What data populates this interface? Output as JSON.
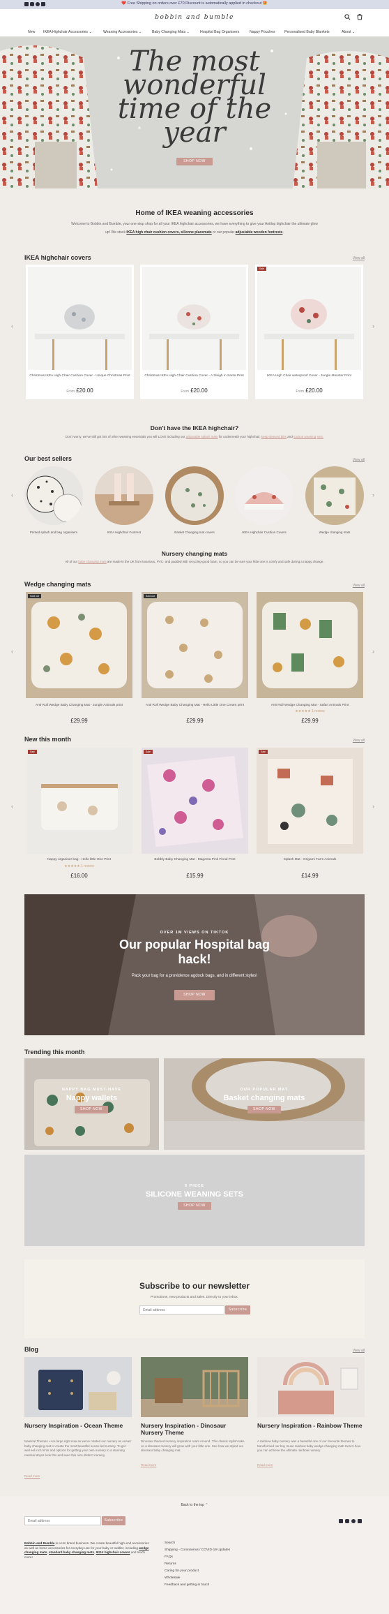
{
  "announcement": {
    "text": "❤️ Free Shipping on orders over £70 Discount is automatically applied in checkout 🤩"
  },
  "header": {
    "logo": "bobbin and bumble"
  },
  "nav": [
    "New",
    "IKEA Highchair Accessories ⌄",
    "Weaning Accessories ⌄",
    "Baby Changing Mats ⌄",
    "Hospital Bag Organisers",
    "Nappy Pouches",
    "Personalised Baby Blankets",
    "About ⌄"
  ],
  "hero": {
    "title": "The most wonderful time of the year",
    "button": "SHOP NOW"
  },
  "intro": {
    "title": "Home of IKEA weaning accessories",
    "line1": "Welcome to Bobbin and Bumble, your one-stop shop for all your IKEA highchair accessories, we have everything to give your Antilop highchair the ultimate glow",
    "line2_pre": "up! We stock ",
    "line2_links": "IKEA high chair cushion covers, silicone placemats",
    "line2_mid": " or our popular ",
    "line2_link2": "adjustable wooden footrests",
    "line2_end": "."
  },
  "ikea": {
    "title": "IKEA highchair covers",
    "view_all": "View all",
    "cards": [
      {
        "title": "Christmas IKEA High Chair Cushion Cover - Unique Christmas Print",
        "from": "From",
        "price": "£20.00",
        "badge": ""
      },
      {
        "title": "Christmas IKEA High Chair Cushion Cover - A Sleigh in Santa Print",
        "from": "From",
        "price": "£20.00",
        "badge": ""
      },
      {
        "title": "IKEA High Chair waterproof Cover - Jungle Monster Print",
        "from": "From",
        "price": "£20.00",
        "badge": "Sale"
      }
    ]
  },
  "no_ikea": {
    "title": "Don't have the IKEA highchair?",
    "line1_pre": "Don't worry, we've still got lots of other weaning essentials you will LOVE including our ",
    "line1_link1": "adjustable splash mats",
    "line1_mid": " for underneath your highchair, ",
    "line1_link2": "keep-sleeved bibs",
    "line1_mid2": " and ",
    "line1_link3": "suction weaning",
    "line2": "sets."
  },
  "best": {
    "title": "Our best sellers",
    "view_all": "View all",
    "items": [
      "Printed splash and bag organisers",
      "IKEA Highchair Footrest",
      "Basket Changing mat covers",
      "IKEA Highchair Cushion Covers",
      "Wedge changing mats"
    ]
  },
  "mats_intro": {
    "title": "Nursery changing mats",
    "pre": "All of our ",
    "link": "baby changing mats",
    "rest": " are made in the UK from luxurious, PVC- and padded with recycling-good foam, so you can be sure your little one is comfy and safe during a nappy",
    "line2": "change."
  },
  "wedge": {
    "title": "Wedge changing mats",
    "view_all": "View all",
    "cards": [
      {
        "title": "Anti Roll Wedge Baby Changing Mat - Jungle Animals print",
        "price": "£29.99",
        "badge": "Sold out",
        "stars": ""
      },
      {
        "title": "Anti Roll Wedge Baby Changing Mat - Hello Little One Cream print",
        "price": "£29.99",
        "badge": "Sold out",
        "stars": ""
      },
      {
        "title": "Anti Roll Wedge Changing Mat - Safari Animals Print",
        "price": "£29.99",
        "badge": "",
        "stars": "★★★★★ 1 review"
      }
    ]
  },
  "new": {
    "title": "New this month",
    "view_all": "View all",
    "cards": [
      {
        "title": "Nappy organiser bag - Hello little One Print",
        "price": "£16.00",
        "badge": "Sale",
        "stars": "★★★★★ 1 review"
      },
      {
        "title": "Bobbly Baby Changing Mat - Magenta Pink Floral Print",
        "price": "£15.99",
        "badge": "Sale",
        "stars": ""
      },
      {
        "title": "Splash Mat - Origami Farm Animals",
        "price": "£14.99",
        "badge": "Sale",
        "stars": ""
      }
    ]
  },
  "tiktok": {
    "over": "OVER 1M VIEWS ON TIKTOK",
    "title1": "Our popular Hospital bag",
    "title2": "hack!",
    "sub": "Pack your bag for a providence agdock bags, and in different styles!",
    "button": "SHOP NOW"
  },
  "trending": {
    "title": "Trending this month",
    "tile1": {
      "over": "NAPPY BAG MUST-HAVE",
      "title": "Nappy wallets",
      "button": "SHOP NOW"
    },
    "tile2": {
      "over": "OUR POPULAR MAT",
      "title": "Basket changing mats",
      "button": "SHOP NOW"
    },
    "tile3": {
      "over": "5 PIECE",
      "title": "SILICONE WEANING SETS",
      "button": "SHOP NOW"
    }
  },
  "newsletter": {
    "title": "Subscribe to our newsletter",
    "sub": "Promotions, new products and sales. Directly to your inbox.",
    "placeholder": "Email address",
    "button": "Subscribe"
  },
  "blog": {
    "title": "Blog",
    "view_all": "View all",
    "posts": [
      {
        "title": "Nursery Inspiration - Ocean Theme",
        "text": "Nautical Themes • Are large right now as we've rotated our nursery as ocean' baby changing mat to create the most beautiful ocean-led nursery. To get well eel inch hints and options for getting your own nursery to a stunning nautical abyss look this and seen this nice distinct nursery.",
        "more": "Read more"
      },
      {
        "title": "Nursery Inspiration - Dinosaur Nursery Theme",
        "text": "Dinosaur themed nursery inspiration roars Around. This classic stylish take on a dinosaur nursery will grow with your little one. See how we styled our dinosaur baby changing mat.",
        "more": "Read more"
      },
      {
        "title": "Nursery Inspiration - Rainbow Theme",
        "text": "A rainbow baby nursery was a beautiful one of our favourite themes to transformed our boy muse rainbow baby wedge changing mat! Here's how you can achieve the ultimate rainbow nursery.",
        "more": "Read more"
      }
    ]
  },
  "footer": {
    "back_top": "Back to the top ⌃",
    "placeholder": "Email address",
    "button": "Subscribe",
    "about_pre": "Bobbin and Bumble",
    "about": " is a UK brand business. We create beautiful high-end accessories as well as home accessories for everyday use for your baby or toddler, including ",
    "about_link1": "wedge changing mats",
    "about_mid": ", ",
    "about_link2": "standard baby changing mats",
    "about_mid2": ", ",
    "about_link3": "IKEA highchair covers",
    "about_end": " and much more!",
    "links": [
      "Search",
      "Shipping - Coronavirus / COVID-19 Updates",
      "FAQs",
      "Returns",
      "Caring for your product",
      "Wholesale",
      "Feedback and getting in touch"
    ]
  },
  "colors": {
    "accent": "#c99a92",
    "badge": "#a13a33",
    "announcement": "#d8dbe8",
    "page": "#f0ece8"
  },
  "icons": [
    "facebook-icon",
    "instagram-icon",
    "pinterest-icon",
    "tiktok-icon",
    "search-icon",
    "cart-icon",
    "chevron-left-icon",
    "chevron-right-icon"
  ]
}
